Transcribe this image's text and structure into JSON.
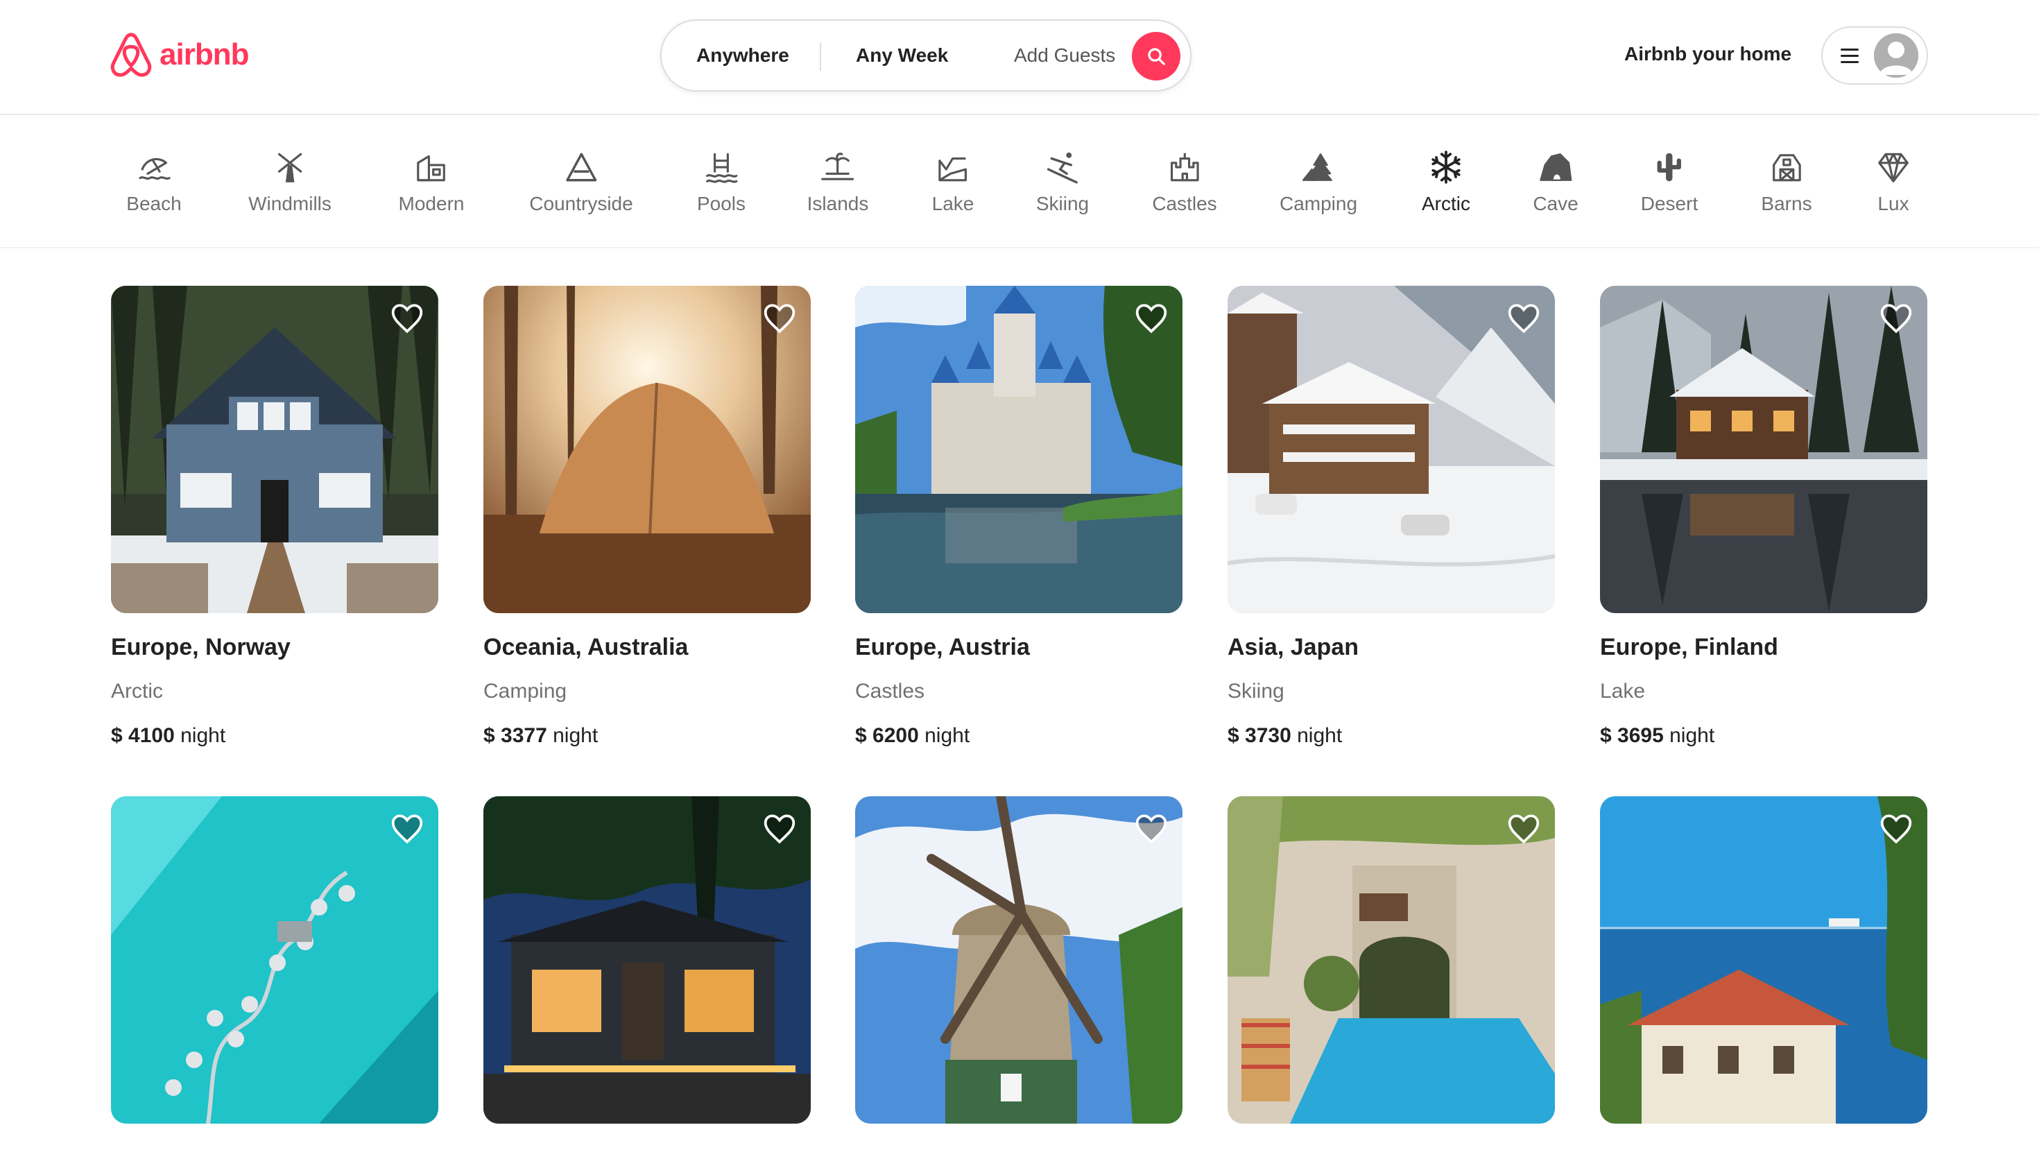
{
  "brand": {
    "name": "airbnb",
    "color": "#ff385c"
  },
  "search": {
    "anywhere": "Anywhere",
    "any_week": "Any Week",
    "add_guests": "Add Guests",
    "button_icon": "search-icon"
  },
  "header": {
    "host_link": "Airbnb your home",
    "menu_icon": "hamburger-icon",
    "avatar_icon": "user-avatar-icon"
  },
  "categories": [
    {
      "label": "Beach",
      "icon": "beach-icon"
    },
    {
      "label": "Windmills",
      "icon": "windmill-icon"
    },
    {
      "label": "Modern",
      "icon": "modern-house-icon"
    },
    {
      "label": "Countryside",
      "icon": "countryside-icon"
    },
    {
      "label": "Pools",
      "icon": "pool-icon"
    },
    {
      "label": "Islands",
      "icon": "island-icon"
    },
    {
      "label": "Lake",
      "icon": "lake-icon"
    },
    {
      "label": "Skiing",
      "icon": "skiing-icon"
    },
    {
      "label": "Castles",
      "icon": "castle-icon"
    },
    {
      "label": "Camping",
      "icon": "camping-icon"
    },
    {
      "label": "Arctic",
      "icon": "snowflake-icon",
      "active": true
    },
    {
      "label": "Cave",
      "icon": "cave-icon"
    },
    {
      "label": "Desert",
      "icon": "cactus-icon"
    },
    {
      "label": "Barns",
      "icon": "barn-icon"
    },
    {
      "label": "Lux",
      "icon": "diamond-icon"
    }
  ],
  "listings": [
    {
      "title": "Europe, Norway",
      "category": "Arctic",
      "currency": "$",
      "price": "4100",
      "unit": "night",
      "photo": "blue cabin in snowy forest"
    },
    {
      "title": "Oceania, Australia",
      "category": "Camping",
      "currency": "$",
      "price": "3377",
      "unit": "night",
      "photo": "tent in sunlit forest"
    },
    {
      "title": "Europe, Austria",
      "category": "Castles",
      "currency": "$",
      "price": "6200",
      "unit": "night",
      "photo": "castle with lake"
    },
    {
      "title": "Asia, Japan",
      "category": "Skiing",
      "currency": "$",
      "price": "3730",
      "unit": "night",
      "photo": "snowy mountain chalet"
    },
    {
      "title": "Europe, Finland",
      "category": "Lake",
      "currency": "$",
      "price": "3695",
      "unit": "night",
      "photo": "cabin by frozen lake"
    },
    {
      "title": "",
      "category": "",
      "currency": "",
      "price": "",
      "unit": "",
      "photo": "overwater villas in turquoise sea"
    },
    {
      "title": "",
      "category": "",
      "currency": "",
      "price": "",
      "unit": "",
      "photo": "modern lit house at night"
    },
    {
      "title": "",
      "category": "",
      "currency": "",
      "price": "",
      "unit": "",
      "photo": "windmill under blue sky"
    },
    {
      "title": "",
      "category": "",
      "currency": "",
      "price": "",
      "unit": "",
      "photo": "courtyard pool"
    },
    {
      "title": "",
      "category": "",
      "currency": "",
      "price": "",
      "unit": "",
      "photo": "villa by the sea"
    }
  ]
}
